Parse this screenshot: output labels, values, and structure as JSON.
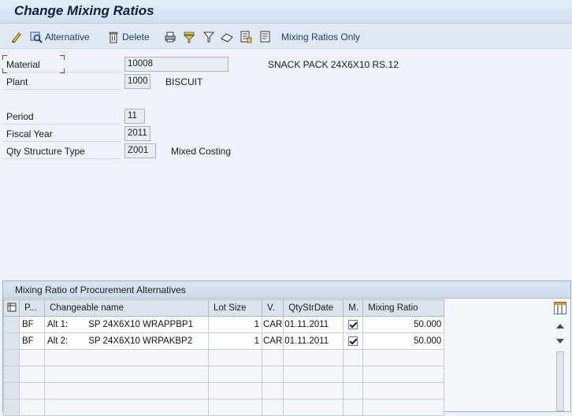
{
  "window": {
    "title": "Change Mixing Ratios"
  },
  "toolbar": {
    "alternative_label": "Alternative",
    "delete_label": "Delete",
    "mixing_ratios_only_label": "Mixing Ratios Only"
  },
  "form": {
    "material": {
      "label": "Material",
      "value": "10008",
      "description": "SNACK PACK 24X6X10 RS.12"
    },
    "plant": {
      "label": "Plant",
      "value": "1000",
      "description": "BISCUIT"
    },
    "period": {
      "label": "Period",
      "value": "11"
    },
    "fiscal_year": {
      "label": "Fiscal Year",
      "value": "2011"
    },
    "qty_structure_type": {
      "label": "Qty Structure Type",
      "value": "Z001",
      "description": "Mixed Costing"
    }
  },
  "panel": {
    "title": "Mixing Ratio of Procurement Alternatives",
    "columns": [
      "P...",
      "Changeable name",
      "Lot Size",
      "V.",
      "QtyStrDate",
      "M.",
      "Mixing Ratio"
    ],
    "rows": [
      {
        "p": "BF",
        "alt": "Alt 1:",
        "name": "SP 24X6X10 WRAPPBP1",
        "lot_size": "1",
        "v": "CAR",
        "date": "01.11.2011",
        "m": true,
        "ratio": "50.000"
      },
      {
        "p": "BF",
        "alt": "Alt 2:",
        "name": "SP 24X6X10 WRPAKBP2",
        "lot_size": "1",
        "v": "CAR",
        "date": "01.11.2011",
        "m": true,
        "ratio": "50.000"
      }
    ]
  },
  "colors": {
    "title_text": "#0c1f3b",
    "toolbar_text": "#1c3d73",
    "required_marker": "#d21a1a"
  }
}
